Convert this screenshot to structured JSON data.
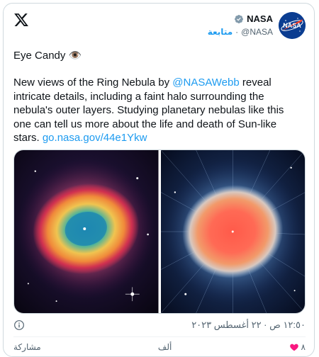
{
  "account": {
    "name": "NASA",
    "handle": "@NASA",
    "follow_label": "متابعة",
    "separator": "·"
  },
  "post": {
    "title": "Eye Candy 👁️",
    "text_before_mention": "New views of the Ring Nebula by ",
    "mention": "@NASAWebb",
    "text_after_mention": " reveal intricate details, including a faint halo surrounding the nebula's outer layers. Studying planetary nebulas like this one can tell us more about the life and death of Sun-like stars. ",
    "link": "go.nasa.gov/44e1Ykw",
    "timestamp": "١٢:٥٠ ص · ٢٢ أغسطس ٢٠٢٣"
  },
  "media": [
    {
      "name": "ring-nebula-nircam-image"
    },
    {
      "name": "ring-nebula-miri-image"
    }
  ],
  "actions": {
    "likes": "٨",
    "reply_label": "ألف",
    "share_label": "مشاركة"
  },
  "icons": {
    "x_logo": "x-logo-icon",
    "verified": "verified-badge-icon",
    "info": "info-icon",
    "like": "heart-icon"
  },
  "colors": {
    "accent": "#1d9bf0",
    "text": "#0f1419",
    "muted": "#536471",
    "border": "#cfd9de",
    "like": "#f91880"
  }
}
